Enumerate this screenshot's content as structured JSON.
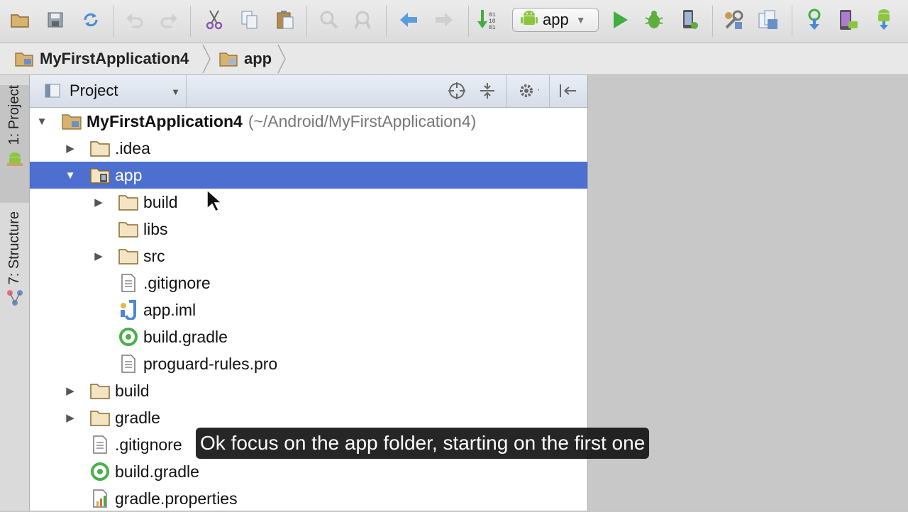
{
  "toolbar": {
    "run_config_label": "app",
    "icons": [
      "open-folder-icon",
      "save-icon",
      "sync-icon",
      "undo-icon",
      "redo-icon",
      "cut-icon",
      "copy-icon",
      "paste-icon",
      "find-icon",
      "replace-icon",
      "back-icon",
      "forward-icon",
      "make-project-icon",
      "run-icon",
      "debug-icon",
      "attach-debugger-icon",
      "project-structure-icon",
      "sdk-manager-icon",
      "sync-gradle-icon",
      "avd-manager-icon",
      "android-device-icon"
    ]
  },
  "breadcrumb": {
    "items": [
      "MyFirstApplication4",
      "app"
    ]
  },
  "sidebar": {
    "project_tab": "1: Project",
    "structure_tab": "7: Structure"
  },
  "panel": {
    "view_label": "Project"
  },
  "tree": {
    "root_name": "MyFirstApplication4",
    "root_path": "(~/Android/MyFirstApplication4)",
    "items": [
      {
        "label": ".idea"
      },
      {
        "label": "app"
      },
      {
        "label": "build"
      },
      {
        "label": "libs"
      },
      {
        "label": "src"
      },
      {
        "label": ".gitignore"
      },
      {
        "label": "app.iml"
      },
      {
        "label": "build.gradle"
      },
      {
        "label": "proguard-rules.pro"
      },
      {
        "label": "build"
      },
      {
        "label": "gradle"
      },
      {
        "label": ".gitignore"
      },
      {
        "label": "build.gradle"
      },
      {
        "label": "gradle.properties"
      }
    ]
  },
  "caption": "Ok focus on the app folder, starting on the first one",
  "colors": {
    "selection": "#4d6fd0",
    "folder": "#c9a467",
    "run_green": "#3fae3f",
    "android_green": "#8cc63f"
  }
}
